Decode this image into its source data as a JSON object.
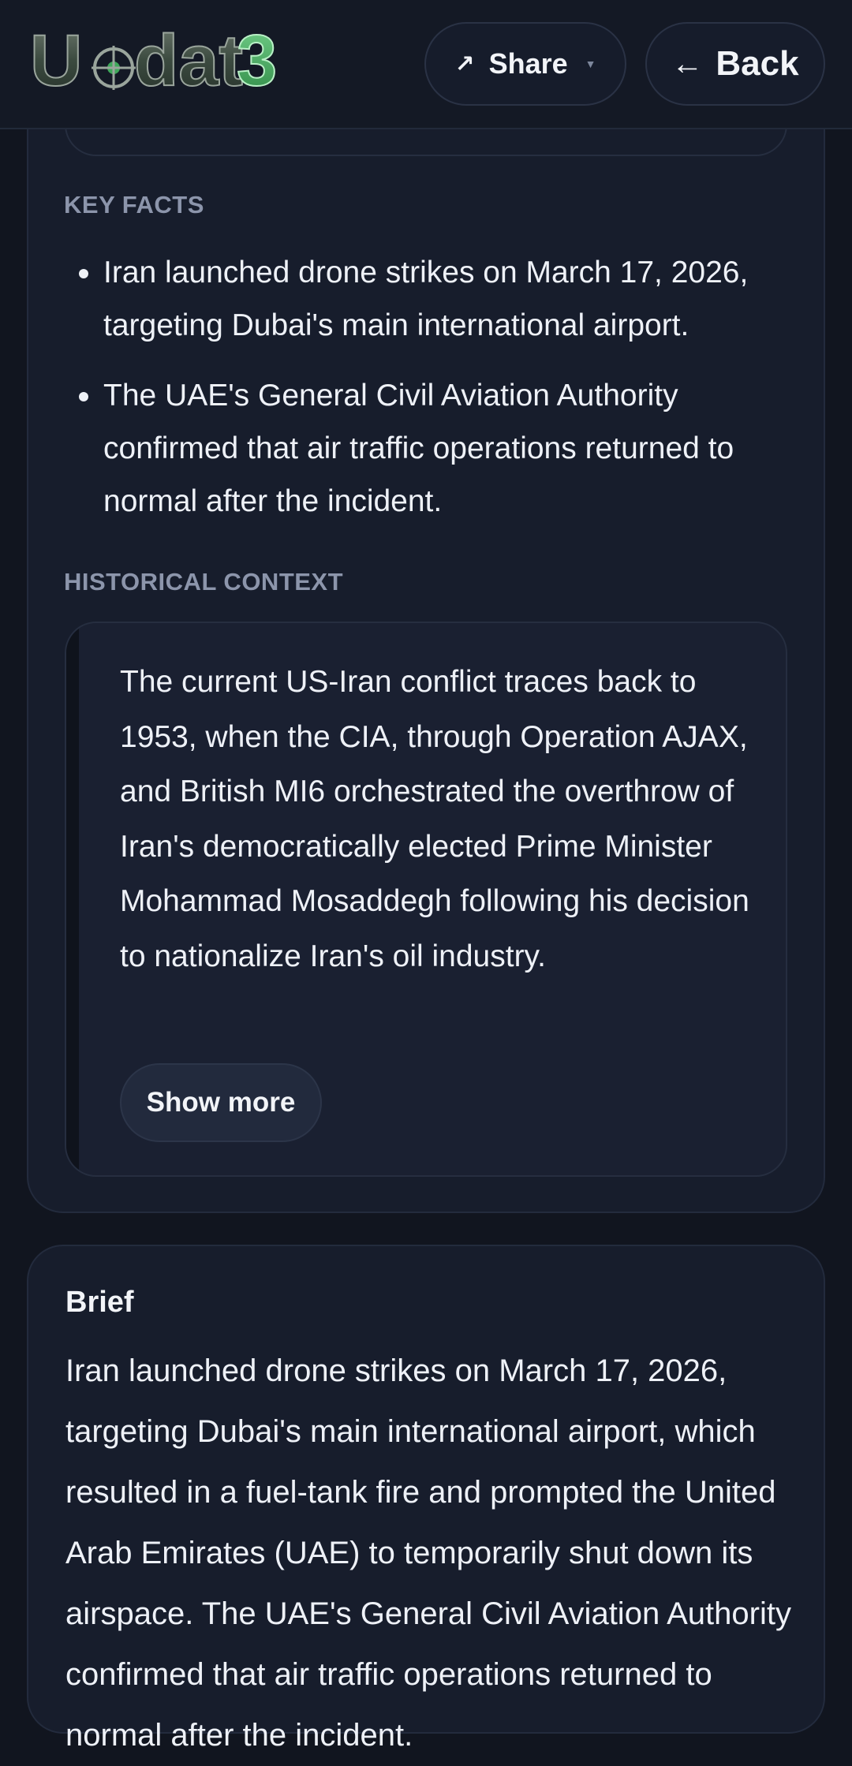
{
  "header": {
    "logo_text": "Updat3",
    "share_label": "Share",
    "back_label": "Back",
    "share_icon": "arrow-northeast-icon",
    "back_icon": "arrow-left-icon"
  },
  "key_facts": {
    "label": "KEY FACTS",
    "items": [
      "Iran launched drone strikes on March 17, 2026, targeting Dubai's main international airport.",
      "The UAE's General Civil Aviation Authority confirmed that air traffic operations returned to normal after the incident."
    ]
  },
  "historical_context": {
    "label": "HISTORICAL CONTEXT",
    "text": "The current US-Iran conflict traces back to 1953, when the CIA, through Operation AJAX, and British MI6 orchestrated the overthrow of Iran's democratically elected Prime Minister Mohammad Mosaddegh following his decision to nationalize Iran's oil industry.",
    "show_more_label": "Show more"
  },
  "brief": {
    "title": "Brief",
    "text": "Iran launched drone strikes on March 17, 2026, targeting Dubai's main international airport, which resulted in a fuel-tank fire and prompted the United Arab Emirates (UAE) to temporarily shut down its airspace. The UAE's General Civil Aviation Authority confirmed that air traffic operations returned to normal after the incident."
  },
  "colors": {
    "background": "#11151f",
    "card": "#171d2c",
    "label": "#8c95ab",
    "logo_green": "#3fa85a"
  }
}
